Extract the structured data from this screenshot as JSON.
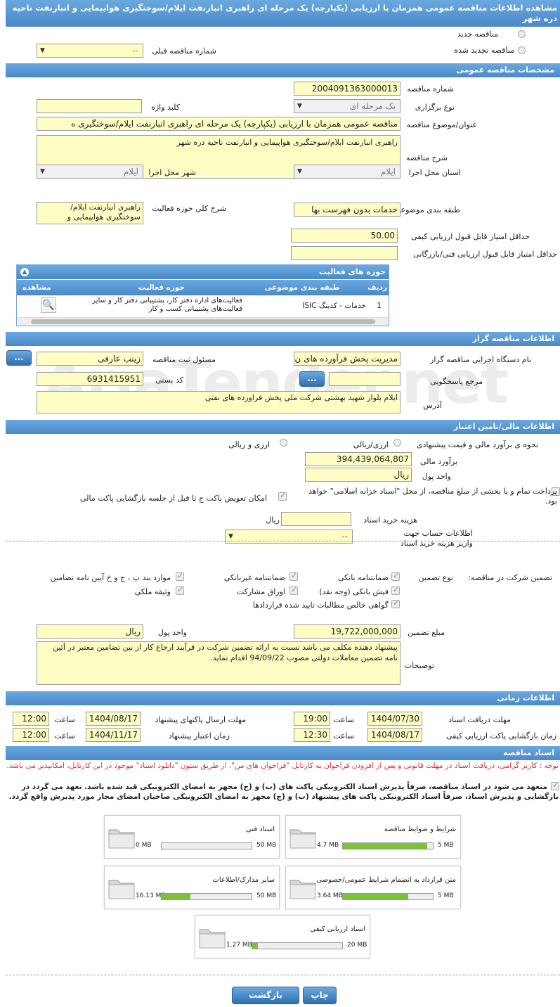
{
  "title": "مشاهده اطلاعات مناقصه عمومی همزمان با ارزیابی (یکپارچه) یک مرحله ای راهبری انبارنفت ایلام/سوختگیری هوایپمایی و انبارنفت ناحیه دره شهر",
  "top": {
    "new_tender": "مناقصه جدید",
    "renewed_tender": "مناقصه تجدید شده",
    "prev_number_label": "شماره مناقصه قبلی",
    "prev_number_value": "--"
  },
  "general": {
    "header": "مشخصات مناقصه عمومی",
    "number_label": "شماره مناقصه",
    "number_value": "2004091363000013",
    "type_label": "نوع برگزاری",
    "type_value": "یک مرحله ای",
    "keyword_label": "کلید واژه",
    "keyword_value": "",
    "subject_label": "عنوان/موضوع مناقصه",
    "subject_value": "مناقصه عمومی همزمان با ارزیابی (یکپارچه) یک مرحله ای راهبری انبارنفت ایلام/سوختگیری ه",
    "desc_label": "شرح مناقصه",
    "desc_value": "راهبری انبارنفت ایلام/سوختگیری هواپیمایی و انبارنفت ناحیه دره شهر",
    "province_label": "استان محل اجرا",
    "province_value": "ایلام",
    "city_label": "شهر محل اجرا",
    "city_value": "ایلام",
    "category_label": "طبقه بندی موضوعی",
    "category_value": "خدمات بدون فهرست بها",
    "scope_label": "شرح کلی حوزه فعالیت",
    "scope_value": "راهبری انبارنفت ایلام/سوختگیری هواپیمایی و",
    "min_quality_label": "حداقل امتیاز قابل قبول ارزیابی کیفی",
    "min_quality_value": "50.00",
    "min_tech_label": "حداقل امتیاز قابل قبول ارزیابی فنی/بازرگانی",
    "min_tech_value": ""
  },
  "activities": {
    "header": "حوزه های فعالیت",
    "cols": [
      "ردیف",
      "طبقه بندی موضوعی",
      "حوزه فعالیت",
      "مشاهده"
    ],
    "row": {
      "idx": "1",
      "category": "خدمات - کدینگ ISIC",
      "field": "فعالیت‌های اداره دفتر کار، پشتیبانی دفتر کار و سایر فعالیت‌های پشتیبانی کسب و کار"
    }
  },
  "organizer": {
    "header": "اطلاعات مناقصه گزار",
    "org_label": "نام دستگاه اجرایی مناقصه گزار",
    "org_value": "مدیریت پخش فرآورده های ن",
    "officer_label": "مسئول ثبت مناقصه",
    "officer_value": "زینب عارفی",
    "ref_label": "مرجع پاسخگویی",
    "ref_value": "",
    "postal_label": "کد پستی",
    "postal_value": "6931415951",
    "address_label": "آدرس",
    "address_value": "ایلام بلوار شهید بهشتی شرکت ملی پخش فراورده های نفتی",
    "dots": "..."
  },
  "finance": {
    "header": "اطلاعات مالی/تامین اعتبار",
    "estimate_method_label": "نحوه ی برآورد مالی و قیمت پیشنهادی",
    "rial_fx": "ارزی/ریالی",
    "fx_and_rial": "ارزی و ریالی",
    "estimate_label": "برآورد مالی",
    "estimate_value": "394,439,064,807",
    "currency_label": "واحد پول",
    "currency_value": "ریال",
    "islamic_treasury": "پرداخت تمام و یا بخشی از مبلغ مناقصه، از محل \"اسناد خزانه اسلامی\" خواهد بود.",
    "envelope_replace": "امکان تعویض پاکت ج تا قبل از جلسه بازگشایی پاکت مالی",
    "doc_price_label": "هزینه خرید اسناد",
    "doc_price_unit": "ریال",
    "account_label": "اطلاعات حساب جهت واریز هزینه خرید اسناد",
    "account_value": "--"
  },
  "guarantee": {
    "participation_label": "تضمین شرکت در مناقصه:",
    "type_label": "نوع تضمین",
    "opt_bank": "ضمانتنامه بانکی",
    "opt_nonbank": "ضمانتنامه غیربانکی",
    "opt_articles": "موارد بند پ ، ج و خ آیین نامه تضامین",
    "opt_cheque": "فیش بانکی (وجه نقد)",
    "opt_bonds": "اوراق مشارکت",
    "opt_property": "وثیقه ملکی",
    "opt_claims": "گواهی خالص مطالبات تایید شده قراردادها",
    "amount_label": "مبلغ تضمین",
    "amount_value": "19,722,000,000",
    "currency_label": "واحد پول",
    "currency_value": "ریال",
    "notes_label": "توضیحات",
    "notes_value": "پیشنهاد دهنده مکلف می باشد نسبت به ارائه تضمین شرکت در فرآیند ارجاع کار از بین تضامین معتبر در آئین نامه تضمین معاملات دولتی مصوب 94/09/22 اقدام نماید."
  },
  "timing": {
    "header": "اطلاعات زمانی",
    "receive_label": "مهلت دریافت اسناد",
    "receive_date": "1404/07/30",
    "receive_time": "19:00",
    "send_label": "مهلت ارسال پاکتهای پیشنهاد",
    "send_date": "1404/08/17",
    "send_time": "12:00",
    "open_label": "زمان بازگشایی پاکت ارزیابی کیفی",
    "open_date": "1404/08/17",
    "open_time": "12:30",
    "validity_label": "زمان اعتبار پیشنهاد",
    "validity_date": "1404/11/17",
    "validity_time": "12:00",
    "time_label": "ساعت"
  },
  "documents": {
    "header": "اسناد مناقصه",
    "notice": "توجه : کاربر گرامی، دریافت اسناد در مهلت قانونی و پس از افزودن فراخوان به کارتابل \"فراخوان های من\"، از طریق ستون \"دانلود اسناد\" موجود در این کارتابل، امکانپذیر می باشد.",
    "commitment": "متعهد می شود در اسناد مناقصه، صرفاً پذیرش اسناد الکترونیکی پاکت های (ب) و (ج) مجهز به امضای الکترونیکی قید شده باشد. تعهد می گردد در بازگشایی و پذیرش اسناد، صرفاً اسناد الکترونیکی پاکت های پیشنهاد (ب) و (ج) مجهز به امضای الکترونیکی صاحبان امضای مجاز مورد پذیرش واقع گردد.",
    "files": [
      {
        "name": "شرایط و ضوابط مناقصه",
        "size": "4.7 MB",
        "max": "5 MB",
        "ratio": 0.94
      },
      {
        "name": "اسناد فنی",
        "size": "0 MB",
        "max": "50 MB",
        "ratio": 0
      },
      {
        "name": "متن قرارداد به انضمام شرایط عمومی/خصوصی",
        "size": "3.64 MB",
        "max": "5 MB",
        "ratio": 0.73
      },
      {
        "name": "سایر مدارک/اطلاعات",
        "size": "16.13 MB",
        "max": "50 MB",
        "ratio": 0.32
      },
      {
        "name": "اسناد ارزیابی کیفی",
        "size": "1.27 MB",
        "max": "20 MB",
        "ratio": 0.06
      }
    ]
  },
  "buttons": {
    "back": "بازگشت",
    "print": "چاپ"
  },
  "watermark": "AriaTender.net"
}
